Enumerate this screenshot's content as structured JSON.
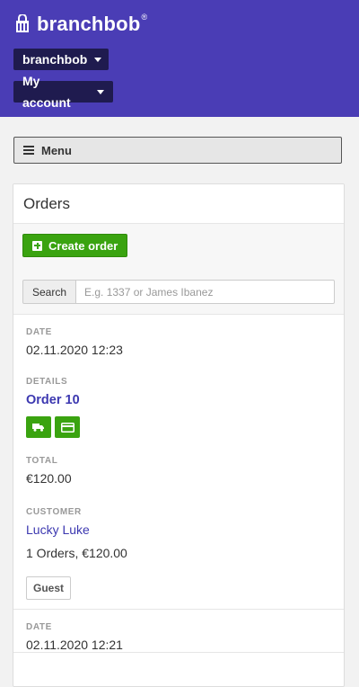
{
  "brand": {
    "name": "branchbob",
    "reg": "®"
  },
  "header": {
    "store_dropdown": "branchbob",
    "account_dropdown": "My account"
  },
  "menu_label": "Menu",
  "panel": {
    "title": "Orders",
    "create_label": "Create order",
    "search_label": "Search",
    "search_placeholder": "E.g. 1337 or James Ibanez"
  },
  "orders": [
    {
      "date_label": "DATE",
      "date": "02.11.2020 12:23",
      "details_label": "DETAILS",
      "order_name": "Order 10",
      "icons": [
        "shipping-truck-icon",
        "credit-card-icon"
      ],
      "total_label": "TOTAL",
      "total": "€120.00",
      "customer_label": "CUSTOMER",
      "customer_name": "Lucky Luke",
      "customer_summary": "1 Orders, €120.00",
      "badge": "Guest"
    },
    {
      "date_label": "DATE",
      "date": "02.11.2020 12:21"
    }
  ],
  "colors": {
    "header_bg": "#4a3db5",
    "dropdown_bg": "#1f1b4f",
    "green": "#3aa310",
    "link": "#3c38b0"
  }
}
